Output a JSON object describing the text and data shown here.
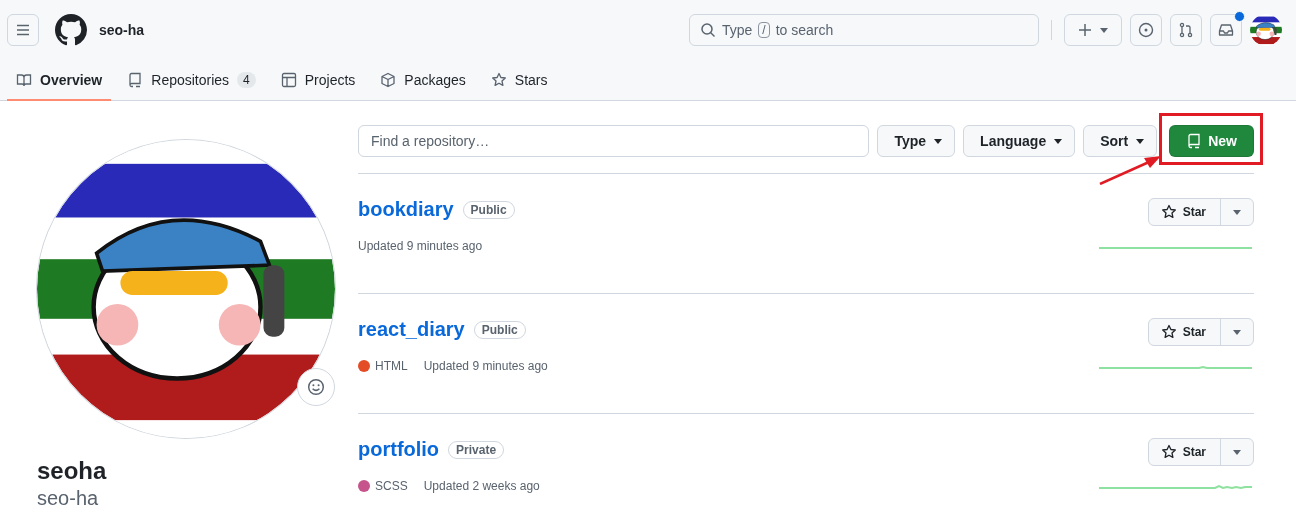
{
  "header": {
    "username": "seo-ha",
    "search": {
      "hint_start": "Type",
      "key": "/",
      "hint_end": "to search"
    },
    "inbox_unread": true
  },
  "tabs": [
    {
      "label": "Overview",
      "kind": "book",
      "selected": true
    },
    {
      "label": "Repositories",
      "kind": "repo",
      "count": "4",
      "selected": false
    },
    {
      "label": "Projects",
      "kind": "table",
      "selected": false
    },
    {
      "label": "Packages",
      "kind": "package",
      "selected": false
    },
    {
      "label": "Stars",
      "kind": "star",
      "selected": false
    }
  ],
  "profile": {
    "name": "seoha",
    "login": "seo-ha"
  },
  "filters": {
    "placeholder": "Find a repository…",
    "menus": [
      "Type",
      "Language",
      "Sort"
    ],
    "new_button": {
      "label": "New",
      "highlighted": true
    }
  },
  "repositories": [
    {
      "name": "bookdiary",
      "visibility": "Public",
      "updated": "Updated 9 minutes ago",
      "star": "Star"
    },
    {
      "name": "react_diary",
      "visibility": "Public",
      "language": "HTML",
      "color": "#e34c26",
      "updated": "Updated 9 minutes ago",
      "star": "Star"
    },
    {
      "name": "portfolio",
      "visibility": "Private",
      "language": "SCSS",
      "color": "#c6538c",
      "updated": "Updated 2 weeks ago",
      "star": "Star"
    }
  ]
}
